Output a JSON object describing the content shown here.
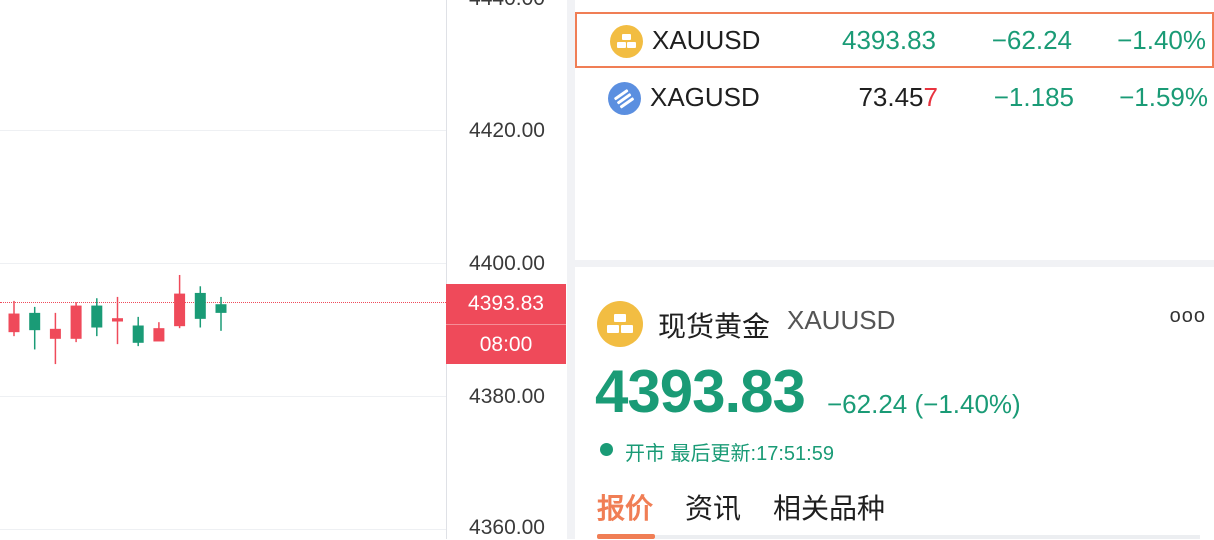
{
  "chart": {
    "y_ticks": [
      "4440.00",
      "4420.00",
      "4400.00",
      "4380.00",
      "4360.00"
    ],
    "last_price_tag": "4393.83",
    "countdown_tag": "08:00",
    "colors": {
      "up": "#1a9b76",
      "down": "#ef4a5a"
    },
    "candles": [
      {
        "o": 4392.4,
        "h": 4394.3,
        "l": 4389.0,
        "c": 4389.6
      },
      {
        "o": 4389.9,
        "h": 4393.4,
        "l": 4387.0,
        "c": 4392.5
      },
      {
        "o": 4390.1,
        "h": 4392.5,
        "l": 4384.8,
        "c": 4388.6
      },
      {
        "o": 4393.6,
        "h": 4394.1,
        "l": 4388.1,
        "c": 4388.6
      },
      {
        "o": 4390.3,
        "h": 4394.7,
        "l": 4389.0,
        "c": 4393.6
      },
      {
        "o": 4391.7,
        "h": 4394.9,
        "l": 4387.8,
        "c": 4391.2
      },
      {
        "o": 4388.0,
        "h": 4391.9,
        "l": 4387.5,
        "c": 4390.6
      },
      {
        "o": 4390.2,
        "h": 4391.1,
        "l": 4388.3,
        "c": 4388.2
      },
      {
        "o": 4395.4,
        "h": 4398.2,
        "l": 4390.2,
        "c": 4390.5
      },
      {
        "o": 4391.6,
        "h": 4396.5,
        "l": 4390.3,
        "c": 4395.5
      },
      {
        "o": 4392.5,
        "h": 4394.9,
        "l": 4389.8,
        "c": 4393.8
      }
    ]
  },
  "watchlist": [
    {
      "symbol": "XAUUSD",
      "last_main": "4393.83",
      "last_tick": "",
      "change": "−62.24",
      "pct": "−1.40%",
      "icon": "gold-bar-icon",
      "icon_color": "#f2bd42",
      "selected": true
    },
    {
      "symbol": "XAGUSD",
      "last_main": "73.45",
      "last_tick": "7",
      "change": "−1.185",
      "pct": "−1.59%",
      "icon": "silver-bars-icon",
      "icon_color": "#5b8fe0",
      "selected": false
    }
  ],
  "detail": {
    "name": "现货黄金",
    "code": "XAUUSD",
    "more": "ooo",
    "price": "4393.83",
    "change": "−62.24 (−1.40%)",
    "status": "开市  最后更新:17:51:59",
    "tabs": [
      "报价",
      "资讯",
      "相关品种"
    ],
    "active_tab": 0
  }
}
